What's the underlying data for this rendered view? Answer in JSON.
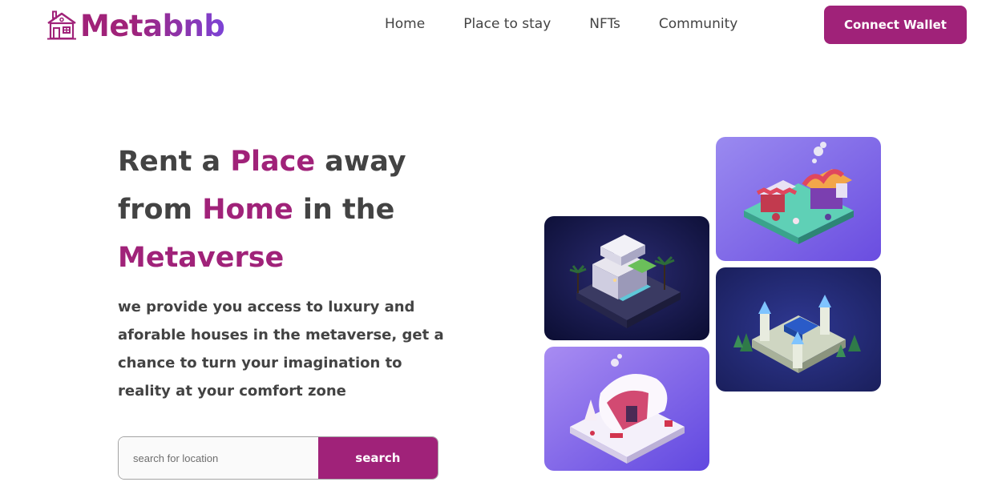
{
  "brand": {
    "name": "Metabnb",
    "icon": "house-logo-icon"
  },
  "nav": {
    "items": [
      {
        "label": "Home"
      },
      {
        "label": "Place to stay"
      },
      {
        "label": "NFTs"
      },
      {
        "label": "Community"
      }
    ],
    "cta_label": "Connect Wallet"
  },
  "hero": {
    "title": {
      "part1": "Rent a ",
      "accent1": "Place",
      "part2": " away from ",
      "accent2": "Home",
      "part3": " in the ",
      "accent3": "Metaverse"
    },
    "description": "we provide you access to luxury and aforable houses in the metaverse, get a chance to turn your imagination to reality at your comfort zone"
  },
  "search": {
    "placeholder": "search for location",
    "button_label": "search"
  },
  "gallery": [
    {
      "icon": "isometric-villa-image"
    },
    {
      "icon": "isometric-market-image"
    },
    {
      "icon": "isometric-castle-image"
    },
    {
      "icon": "isometric-snow-cabin-image"
    }
  ],
  "colors": {
    "accent": "#a02279",
    "text": "#434343",
    "logo_gradient_end": "#7c43d6"
  }
}
